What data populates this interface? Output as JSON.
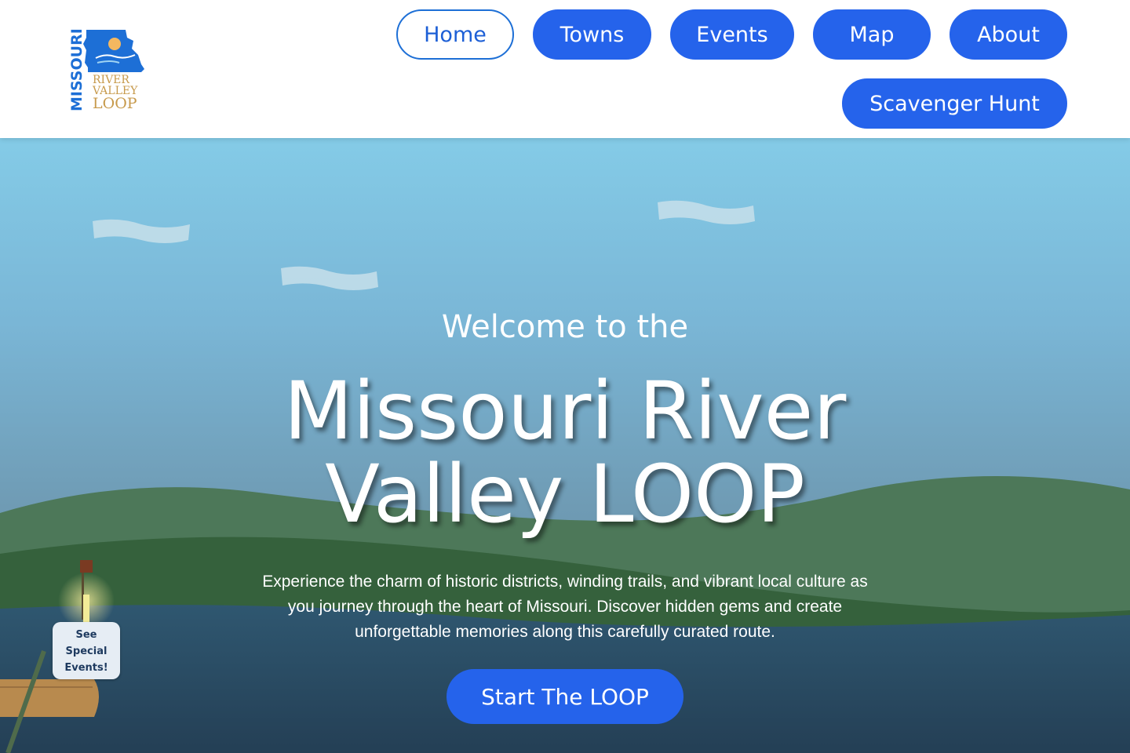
{
  "header": {
    "logo": {
      "text_vertical": "MISSOURI",
      "text_line1": "RIVER",
      "text_line2": "VALLEY",
      "text_line3": "LOOP",
      "colors": {
        "blue": "#1d6fd6",
        "gold": "#c79a4c"
      }
    },
    "nav": [
      {
        "label": "Home",
        "active": true
      },
      {
        "label": "Towns",
        "active": false
      },
      {
        "label": "Events",
        "active": false
      },
      {
        "label": "Map",
        "active": false
      },
      {
        "label": "About",
        "active": false
      },
      {
        "label": "Scavenger Hunt",
        "active": false
      }
    ]
  },
  "hero": {
    "welcome": "Welcome to the",
    "title_line1": "Missouri River",
    "title_line2": "Valley LOOP",
    "description": "Experience the charm of historic districts, winding trails, and vibrant local culture as you journey through the heart of Missouri. Discover hidden gems and create unforgettable memories along this carefully curated route.",
    "cta_label": "Start The LOOP",
    "special_events": [
      "See",
      "Special",
      "Events!"
    ]
  },
  "colors": {
    "accent": "#2563eb",
    "sky_top": "#84cbe7",
    "hill": "#3f6b47",
    "river": "#2a4b63"
  }
}
